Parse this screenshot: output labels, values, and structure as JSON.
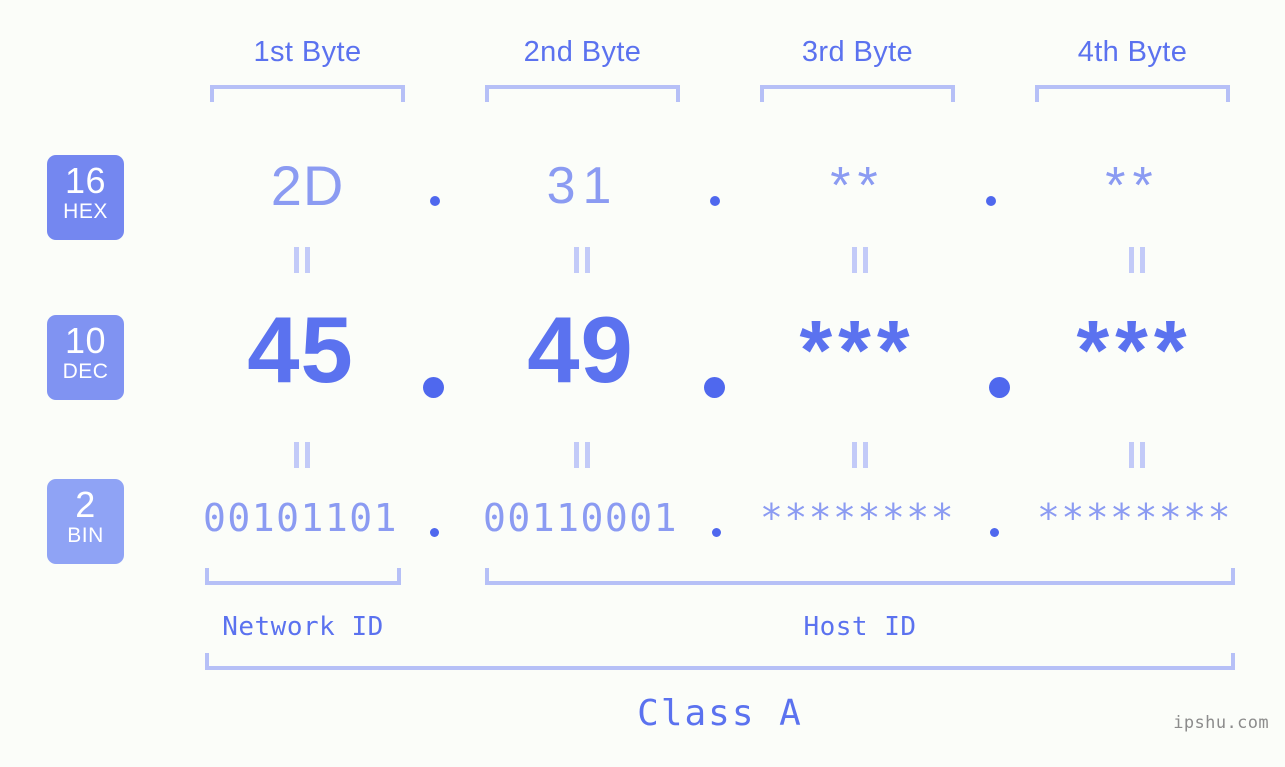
{
  "page": {
    "background_color": "#fbfdf9",
    "accent_color": "#5b72ef",
    "accent_light_color": "#8b9bf2",
    "bracket_color": "#b6c0f7",
    "watermark": "ipshu.com"
  },
  "byte_headers": [
    {
      "label": "1st Byte"
    },
    {
      "label": "2nd Byte"
    },
    {
      "label": "3rd Byte"
    },
    {
      "label": "4th Byte"
    }
  ],
  "radix_rows": [
    {
      "base": "16",
      "name": "HEX",
      "badge_color": "#7487f0",
      "values": [
        "2D",
        "31",
        "**",
        "**"
      ],
      "separator": "."
    },
    {
      "base": "10",
      "name": "DEC",
      "badge_color": "#8093f2",
      "values": [
        "45",
        "49",
        "***",
        "***"
      ],
      "separator": "."
    },
    {
      "base": "2",
      "name": "BIN",
      "badge_color": "#8fa3f5",
      "values": [
        "00101101",
        "00110001",
        "********",
        "********"
      ],
      "separator": "."
    }
  ],
  "equals_symbol": "=",
  "sections": {
    "network_id": "Network ID",
    "host_id": "Host ID",
    "class": "Class A"
  }
}
